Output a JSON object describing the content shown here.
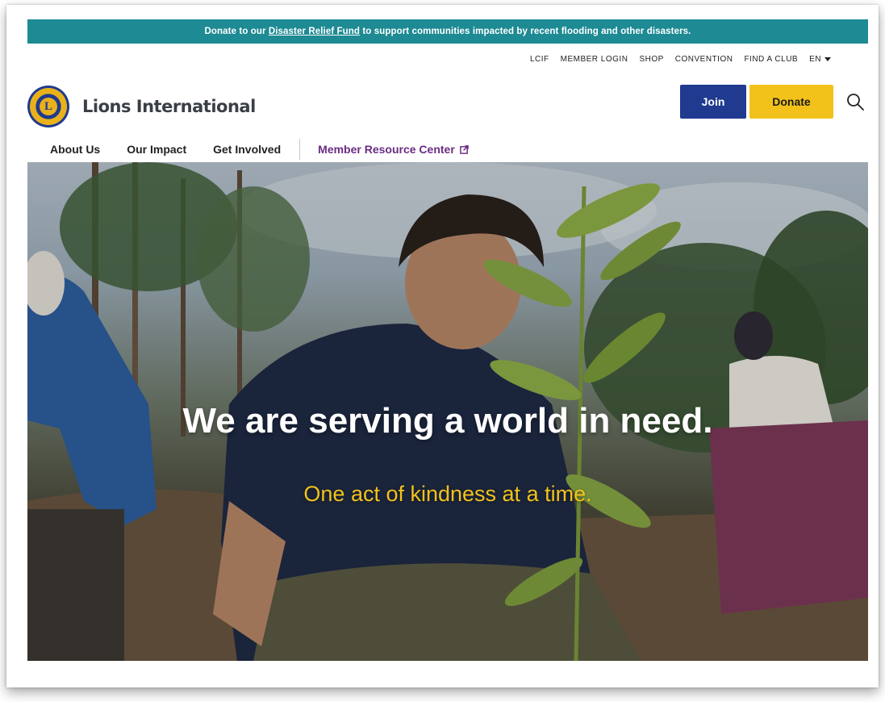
{
  "alert": {
    "prefix": "Donate to our ",
    "link": "Disaster Relief Fund",
    "suffix": " to support communities impacted by recent flooding and other disasters."
  },
  "brand": {
    "name": "Lions International",
    "logo_letter": "L"
  },
  "utility_nav": [
    "LCIF",
    "MEMBER LOGIN",
    "SHOP",
    "CONVENTION",
    "FIND A CLUB"
  ],
  "language": "EN",
  "buttons": {
    "join": "Join",
    "donate": "Donate"
  },
  "main_nav": [
    "About Us",
    "Our Impact",
    "Get Involved"
  ],
  "member_resource_center": "Member Resource Center",
  "hero": {
    "headline": "We are serving a world in need.",
    "subheadline": "One act of kindness at a time."
  },
  "colors": {
    "alert_bg": "#1e8a93",
    "join_bg": "#1f3a8f",
    "donate_bg": "#f2c21a",
    "mrc_text": "#6b2c82",
    "hero_sub": "#f2c21a"
  },
  "icons": {
    "search": "search-icon",
    "external": "external-link-icon",
    "language_caret": "chevron-down-icon"
  }
}
